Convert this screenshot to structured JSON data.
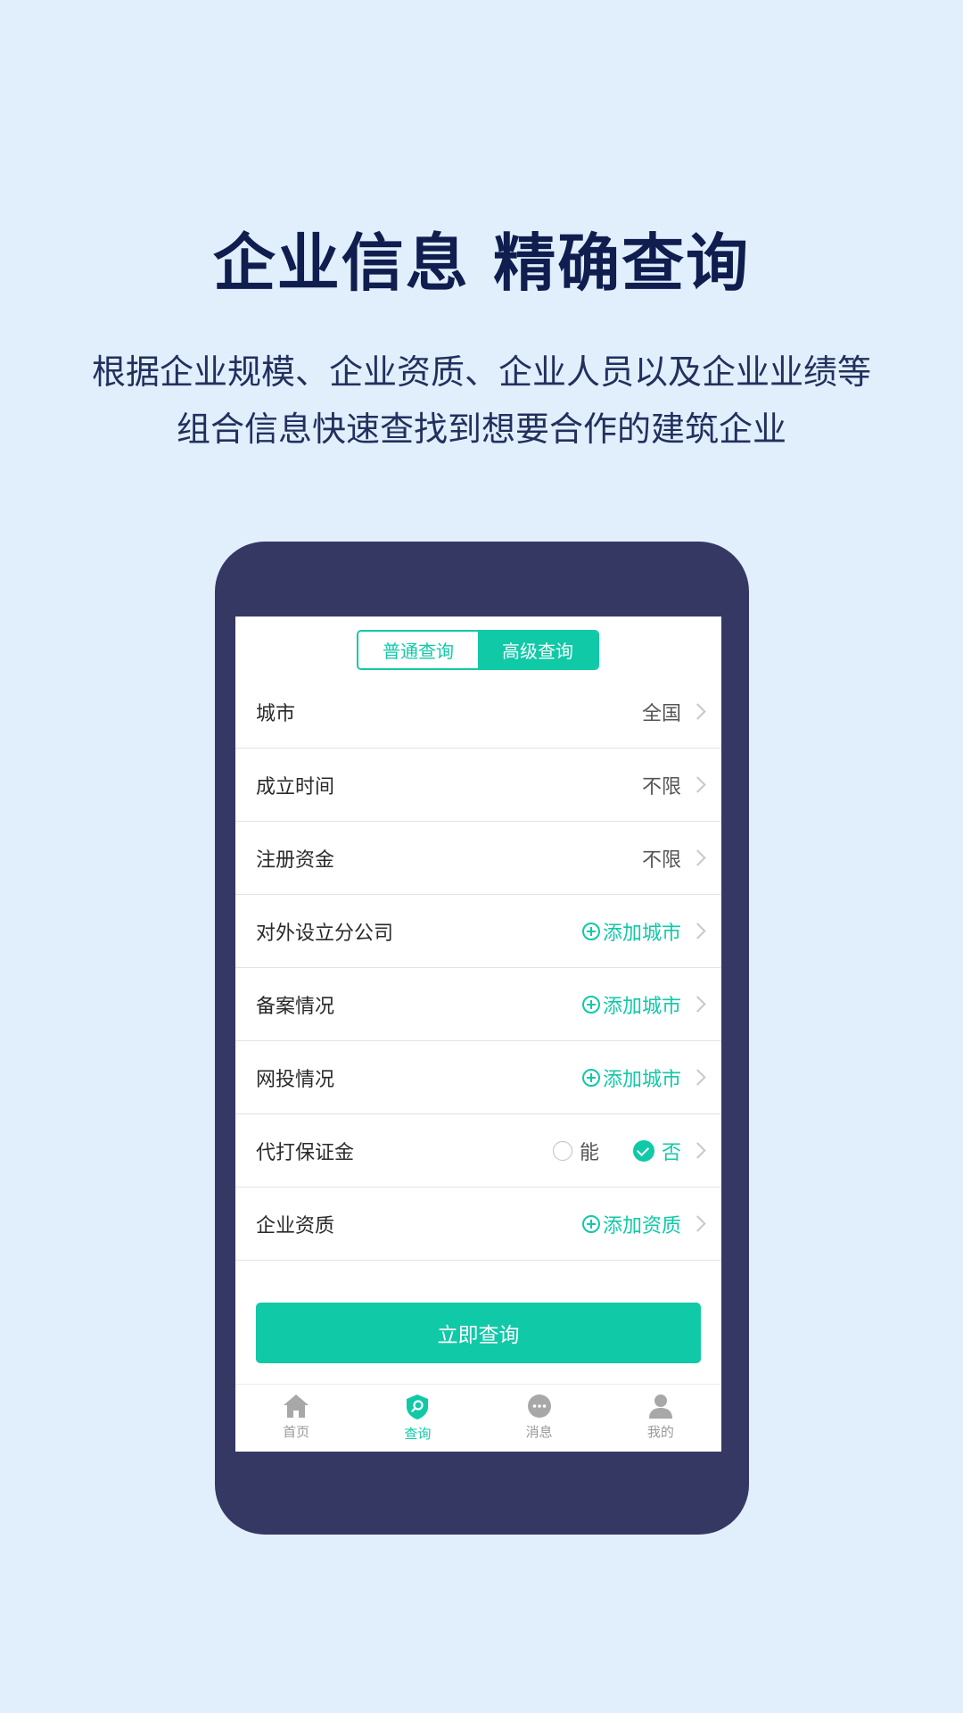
{
  "promo": {
    "headline": "企业信息 精确查询",
    "subline_1": "根据企业规模、企业资质、企业人员以及企业业绩等",
    "subline_2": "组合信息快速查找到想要合作的建筑企业"
  },
  "tabs": [
    {
      "label": "普通查询",
      "active": false
    },
    {
      "label": "高级查询",
      "active": true
    }
  ],
  "filters": [
    {
      "label": "城市",
      "value": "全国",
      "type": "value"
    },
    {
      "label": "成立时间",
      "value": "不限",
      "type": "value"
    },
    {
      "label": "注册资金",
      "value": "不限",
      "type": "value"
    },
    {
      "label": "对外设立分公司",
      "value": "添加城市",
      "type": "add"
    },
    {
      "label": "备案情况",
      "value": "添加城市",
      "type": "add"
    },
    {
      "label": "网投情况",
      "value": "添加城市",
      "type": "add"
    },
    {
      "label": "代打保证金",
      "type": "radio",
      "options": [
        "能",
        "否"
      ],
      "selected": "否"
    },
    {
      "label": "企业资质",
      "value": "添加资质",
      "type": "add"
    }
  ],
  "query_button": "立即查询",
  "nav": [
    {
      "label": "首页",
      "icon": "home-icon",
      "active": false
    },
    {
      "label": "查询",
      "icon": "search-shield-icon",
      "active": true
    },
    {
      "label": "消息",
      "icon": "message-icon",
      "active": false
    },
    {
      "label": "我的",
      "icon": "user-icon",
      "active": false
    }
  ],
  "colors": {
    "accent": "#10c9a7",
    "background": "#e1effd",
    "phone_frame": "#363864",
    "headline": "#0f1d4f"
  }
}
